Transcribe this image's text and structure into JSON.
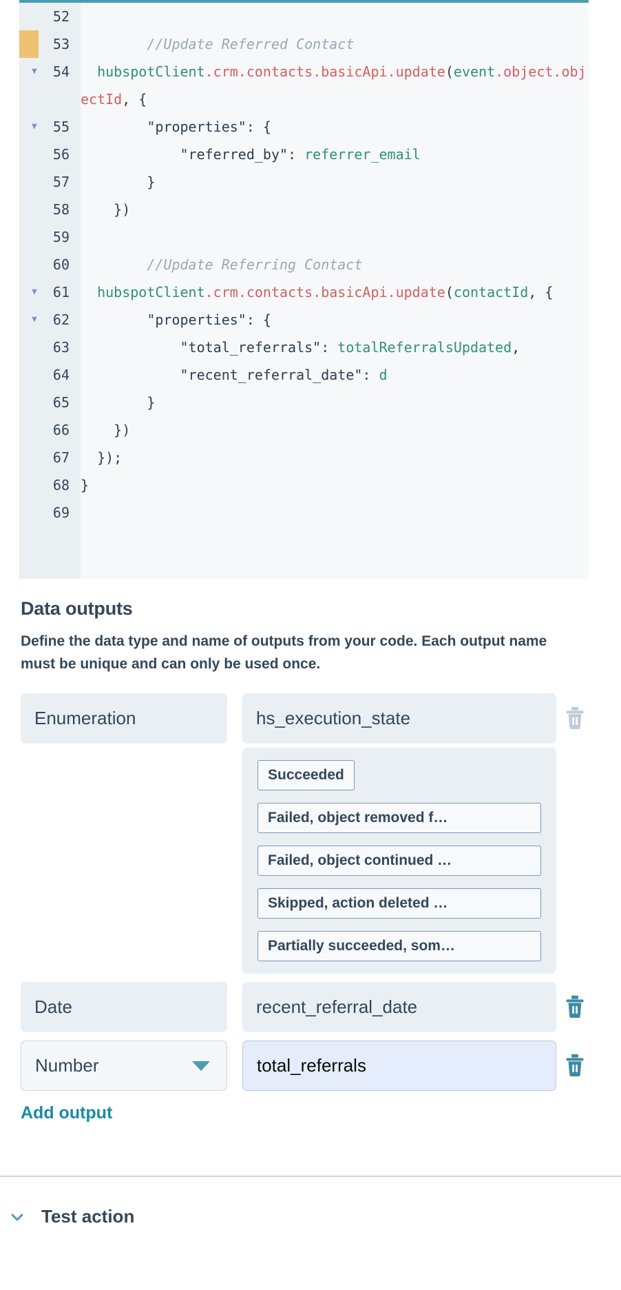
{
  "editor": {
    "top_accent_color": "#4a9cb3",
    "gutter_bg": "#eaeff2",
    "marker_color": "#eec172",
    "marker_line": "53",
    "lines": [
      {
        "n": "52",
        "fold": false,
        "segments": []
      },
      {
        "n": "53",
        "fold": false,
        "marker": true,
        "segments": [
          {
            "t": "        ",
            "c": "plain"
          },
          {
            "t": "//Update Referred Contact",
            "c": "comment"
          }
        ]
      },
      {
        "n": "54",
        "fold": true,
        "segments": [
          {
            "t": "  ",
            "c": "plain"
          },
          {
            "t": "hubspotClient",
            "c": "green"
          },
          {
            "t": ".crm",
            "c": "red"
          },
          {
            "t": ".contacts",
            "c": "red"
          },
          {
            "t": ".basicApi",
            "c": "red"
          },
          {
            "t": ".update",
            "c": "red"
          },
          {
            "t": "(",
            "c": "plain"
          },
          {
            "t": "event",
            "c": "green"
          },
          {
            "t": ".object",
            "c": "red"
          },
          {
            "t": ".objectId",
            "c": "red"
          },
          {
            "t": ", {",
            "c": "plain"
          }
        ]
      },
      {
        "n": "55",
        "fold": true,
        "segments": [
          {
            "t": "        \"properties\": {",
            "c": "plain"
          }
        ]
      },
      {
        "n": "56",
        "fold": false,
        "segments": [
          {
            "t": "            \"referred_by\": ",
            "c": "plain"
          },
          {
            "t": "referrer_email",
            "c": "green"
          }
        ]
      },
      {
        "n": "57",
        "fold": false,
        "segments": [
          {
            "t": "        }",
            "c": "plain"
          }
        ]
      },
      {
        "n": "58",
        "fold": false,
        "segments": [
          {
            "t": "    })",
            "c": "plain"
          }
        ]
      },
      {
        "n": "59",
        "fold": false,
        "segments": []
      },
      {
        "n": "60",
        "fold": false,
        "segments": [
          {
            "t": "        ",
            "c": "plain"
          },
          {
            "t": "//Update Referring Contact",
            "c": "comment"
          }
        ]
      },
      {
        "n": "61",
        "fold": true,
        "segments": [
          {
            "t": "  ",
            "c": "plain"
          },
          {
            "t": "hubspotClient",
            "c": "green"
          },
          {
            "t": ".crm",
            "c": "red"
          },
          {
            "t": ".contacts",
            "c": "red"
          },
          {
            "t": ".basicApi",
            "c": "red"
          },
          {
            "t": ".update",
            "c": "red"
          },
          {
            "t": "(",
            "c": "plain"
          },
          {
            "t": "contactId",
            "c": "green"
          },
          {
            "t": ", {",
            "c": "plain"
          }
        ]
      },
      {
        "n": "62",
        "fold": true,
        "segments": [
          {
            "t": "        \"properties\": {",
            "c": "plain"
          }
        ]
      },
      {
        "n": "63",
        "fold": false,
        "segments": [
          {
            "t": "            \"total_referrals\": ",
            "c": "plain"
          },
          {
            "t": "totalReferralsUpdated",
            "c": "green"
          },
          {
            "t": ",",
            "c": "plain"
          }
        ]
      },
      {
        "n": "64",
        "fold": false,
        "segments": [
          {
            "t": "            \"recent_referral_date\": ",
            "c": "plain"
          },
          {
            "t": "d",
            "c": "green"
          }
        ]
      },
      {
        "n": "65",
        "fold": false,
        "segments": [
          {
            "t": "        }",
            "c": "plain"
          }
        ]
      },
      {
        "n": "66",
        "fold": false,
        "segments": [
          {
            "t": "    })",
            "c": "plain"
          }
        ]
      },
      {
        "n": "67",
        "fold": false,
        "segments": [
          {
            "t": "  });",
            "c": "plain"
          }
        ]
      },
      {
        "n": "68",
        "fold": false,
        "segments": [
          {
            "t": "}",
            "c": "plain"
          }
        ]
      },
      {
        "n": "69",
        "fold": false,
        "segments": []
      }
    ]
  },
  "data_outputs": {
    "title": "Data outputs",
    "description": "Define the data type and name of outputs from your code. Each output name must be unique and can only be used once.",
    "add_output_label": "Add output",
    "rows": [
      {
        "type": "Enumeration",
        "name": "hs_execution_state",
        "type_editable": false,
        "name_focused": false,
        "delete_icon": "trash-icon",
        "delete_color": "#bfcbd9",
        "options": [
          "Succeeded",
          "Failed, object removed f…",
          "Failed, object continued …",
          "Skipped, action deleted …",
          "Partially succeeded, som…"
        ]
      },
      {
        "type": "Date",
        "name": "recent_referral_date",
        "type_editable": false,
        "name_focused": false,
        "delete_icon": "trash-icon",
        "delete_color": "#3c8ba6",
        "options": []
      },
      {
        "type": "Number",
        "name": "total_referrals",
        "type_editable": true,
        "name_focused": true,
        "delete_icon": "trash-icon",
        "delete_color": "#3c8ba6",
        "options": []
      }
    ]
  },
  "test_action": {
    "label": "Test action",
    "chevron_icon": "chevron-down-icon",
    "chevron_color": "#4a9cb3"
  }
}
